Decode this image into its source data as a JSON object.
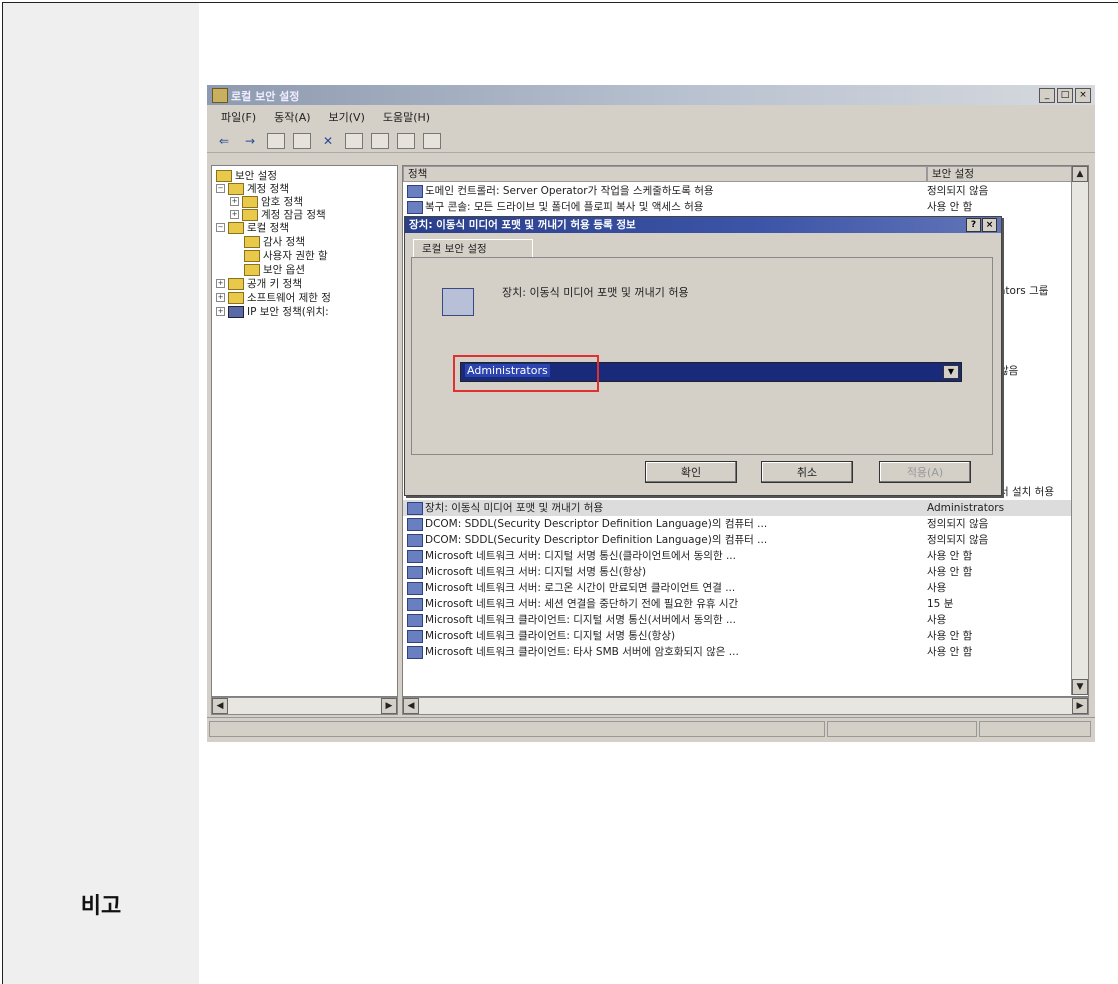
{
  "remark_label": "비고",
  "window": {
    "title": "로컬 보안 설정",
    "buttons": [
      "_",
      "□",
      "×"
    ],
    "menu": [
      "파일(F)",
      "동작(A)",
      "보기(V)",
      "도움말(H)"
    ]
  },
  "tree": {
    "root": "보안 설정",
    "items": [
      {
        "label": "계정 정책",
        "level": 1
      },
      {
        "label": "암호 정책",
        "level": 2
      },
      {
        "label": "계정 잠금 정책",
        "level": 2
      },
      {
        "label": "로컬 정책",
        "level": 1
      },
      {
        "label": "감사 정책",
        "level": 2
      },
      {
        "label": "사용자 권한 할",
        "level": 2
      },
      {
        "label": "보안 옵션",
        "level": 2
      },
      {
        "label": "공개 키 정책",
        "level": 1
      },
      {
        "label": "소프트웨어 제한 정",
        "level": 1
      },
      {
        "label": "IP 보안 정책(위치:",
        "level": 1
      }
    ]
  },
  "list": {
    "col_policy": "정책",
    "col_setting": "보안 설정",
    "top_rows": [
      {
        "policy": "도메인 컨트롤러: Server Operator가 작업을 스케줄하도록 허용",
        "value": "정의되지 않음"
      },
      {
        "policy": "복구 콘솔: 모든 드라이브 및 폴더에 플로피 복사 및 액세스 허용",
        "value": "사용 안 함"
      }
    ],
    "partial_values": [
      "ators 그룹",
      "않음",
      "서 설치 허용"
    ],
    "bottom_rows": [
      {
        "policy": "장치: 이동식 미디어 포맷 및 꺼내기 허용",
        "value": "Administrators",
        "selected": true
      },
      {
        "policy": "DCOM: SDDL(Security Descriptor Definition Language)의 컴퓨터 ...",
        "value": "정의되지 않음"
      },
      {
        "policy": "DCOM: SDDL(Security Descriptor Definition Language)의 컴퓨터 ...",
        "value": "정의되지 않음"
      },
      {
        "policy": "Microsoft 네트워크 서버: 디지털 서명 통신(클라이언트에서 동의한 ...",
        "value": "사용 안 함"
      },
      {
        "policy": "Microsoft 네트워크 서버: 디지털 서명 통신(항상)",
        "value": "사용 안 함"
      },
      {
        "policy": "Microsoft 네트워크 서버: 로그온 시간이 만료되면 클라이언트 연결 ...",
        "value": "사용"
      },
      {
        "policy": "Microsoft 네트워크 서버: 세션 연결을 중단하기 전에 필요한 유휴 시간",
        "value": "15 분"
      },
      {
        "policy": "Microsoft 네트워크 클라이언트: 디지털 서명 통신(서버에서 동의한 ...",
        "value": "사용"
      },
      {
        "policy": "Microsoft 네트워크 클라이언트: 디지털 서명 통신(항상)",
        "value": "사용 안 함"
      },
      {
        "policy": "Microsoft 네트워크 클라이언트: 타사 SMB 서버에 암호화되지 않은 ...",
        "value": "사용 안 함"
      }
    ]
  },
  "dialog": {
    "title": "장치: 이동식 미디어 포맷 및 꺼내기 허용 등록 정보",
    "title_buttons": [
      "?",
      "×"
    ],
    "tab": "로컬 보안 설정",
    "description": "장치: 이동식 미디어 포맷 및 꺼내기 허용",
    "selected_value": "Administrators",
    "ok": "확인",
    "cancel": "취소",
    "apply": "적용(A)"
  }
}
